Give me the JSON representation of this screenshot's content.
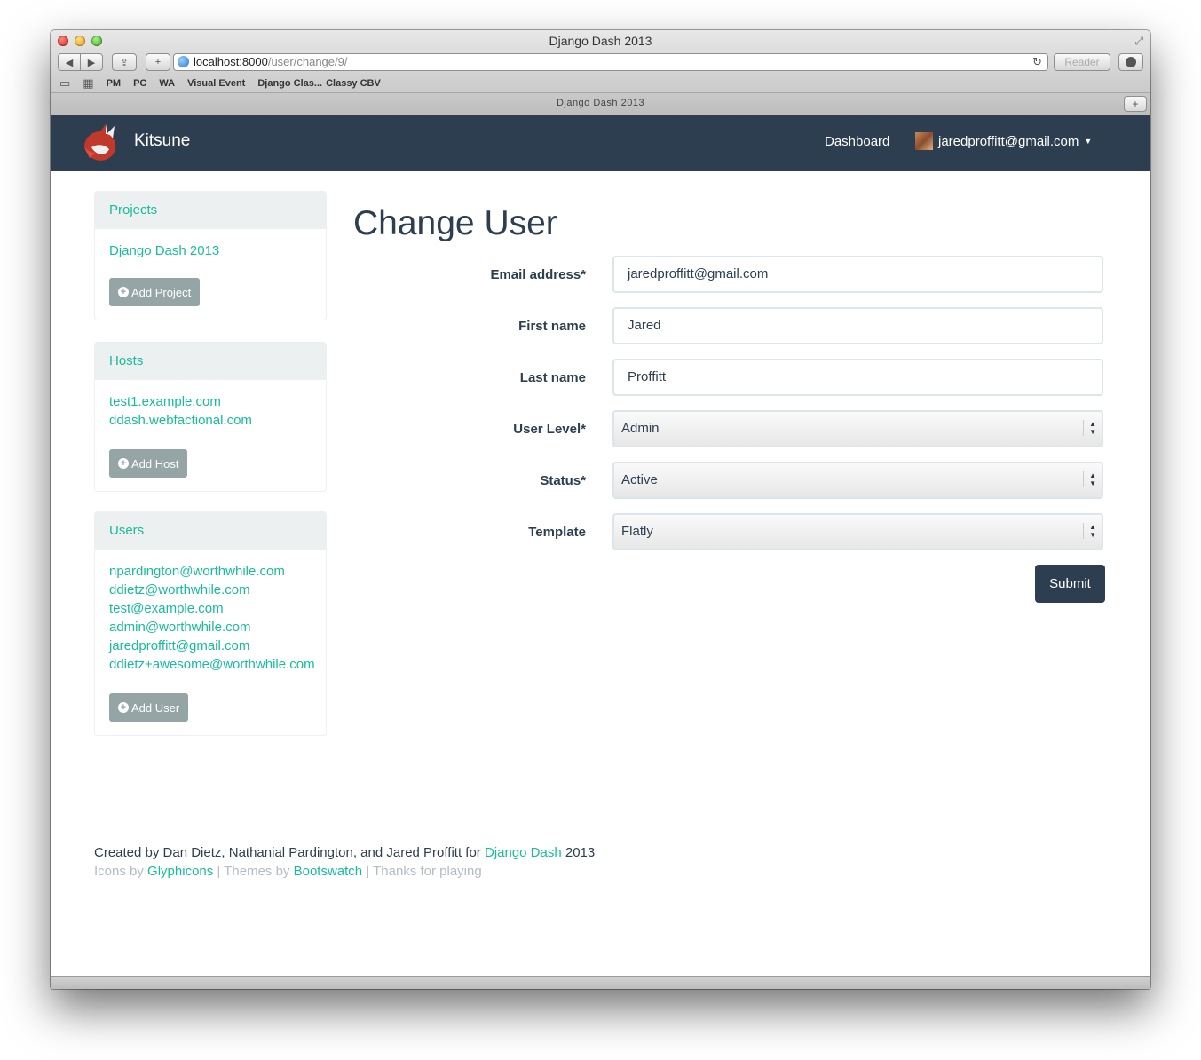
{
  "browser": {
    "window_title": "Django Dash 2013",
    "url_host": "localhost:8000",
    "url_path": "/user/change/9/",
    "reader_label": "Reader",
    "bookmarks": [
      "PM",
      "PC",
      "WA",
      "Visual Event",
      "Django Clas...",
      "Classy CBV"
    ],
    "tab_title": "Django Dash 2013"
  },
  "navbar": {
    "brand": "Kitsune",
    "dashboard_label": "Dashboard",
    "user_email": "jaredproffitt@gmail.com"
  },
  "sidebar": {
    "projects": {
      "heading": "Projects",
      "items": [
        "Django Dash 2013"
      ],
      "button": "Add Project"
    },
    "hosts": {
      "heading": "Hosts",
      "items": [
        "test1.example.com",
        "ddash.webfactional.com"
      ],
      "button": "Add Host"
    },
    "users": {
      "heading": "Users",
      "items": [
        "npardington@worthwhile.com",
        "ddietz@worthwhile.com",
        "test@example.com",
        "admin@worthwhile.com",
        "jaredproffitt@gmail.com",
        "ddietz+awesome@worthwhile.com"
      ],
      "button": "Add User"
    }
  },
  "form": {
    "title": "Change User",
    "email_label": "Email address*",
    "email_value": "jaredproffitt@gmail.com",
    "first_name_label": "First name",
    "first_name_value": "Jared",
    "last_name_label": "Last name",
    "last_name_value": "Proffitt",
    "user_level_label": "User Level*",
    "user_level_value": "Admin",
    "status_label": "Status*",
    "status_value": "Active",
    "template_label": "Template",
    "template_value": "Flatly",
    "submit_label": "Submit"
  },
  "footer": {
    "credits_prefix": "Created by Dan Dietz, Nathanial Pardington, and Jared Proffitt for",
    "credits_link": "Django Dash",
    "credits_suffix": "2013",
    "icons_prefix": "Icons by",
    "icons_link": "Glyphicons",
    "sep1": "|",
    "themes_prefix": "Themes by",
    "themes_link": "Bootswatch",
    "sep2": "|",
    "thanks": "Thanks for playing"
  },
  "colors": {
    "navbar": "#2c3e50",
    "accent": "#18bc9c",
    "muted_button": "#95a5a6"
  }
}
